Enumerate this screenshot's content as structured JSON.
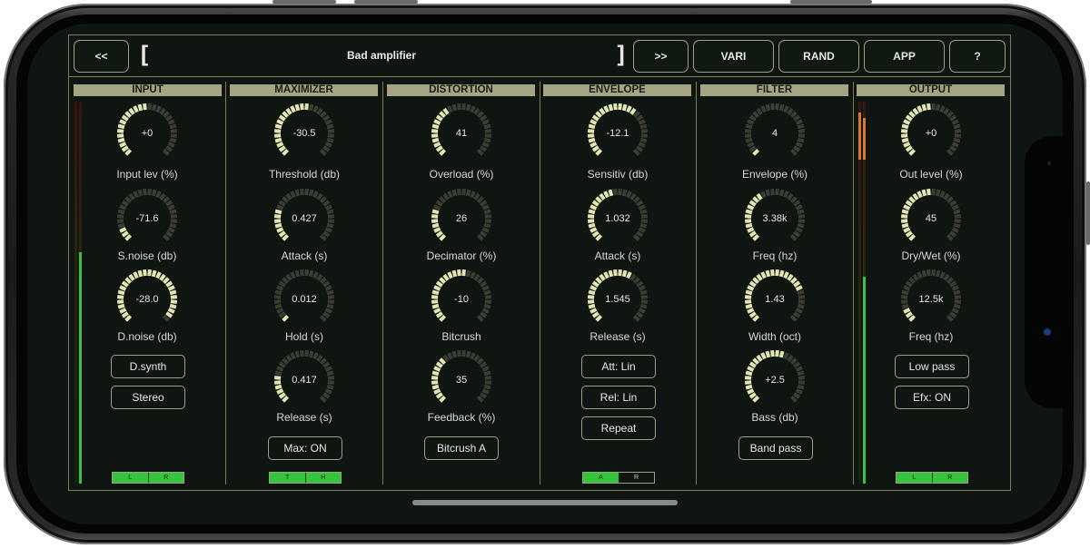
{
  "header": {
    "prev_label": "<<",
    "next_label": ">>",
    "preset_name": "Bad amplifier",
    "bracket_left": "[",
    "bracket_right": "]",
    "vari_label": "VARI",
    "rand_label": "RAND",
    "app_label": "APP",
    "help_label": "?"
  },
  "colors": {
    "accent_green": "#35c43b",
    "knob_on": "#e3e6b4",
    "knob_off": "#3a3d33",
    "header_bg": "#a6a583"
  },
  "sections": {
    "input": {
      "title": "INPUT",
      "knobs": [
        {
          "label": "Input lev (%)",
          "value": "+0",
          "fill": 0.5
        },
        {
          "label": "S.noise (db)",
          "value": "-71.6",
          "fill": 0.1
        },
        {
          "label": "D.noise (db)",
          "value": "-28.0",
          "fill": 0.95
        }
      ],
      "buttons": [
        "D.synth",
        "Stereo"
      ],
      "toggle": [
        "L",
        "R"
      ]
    },
    "maximizer": {
      "title": "MAXIMIZER",
      "knobs": [
        {
          "label": "Threshold (db)",
          "value": "-30.5",
          "fill": 0.55
        },
        {
          "label": "Attack (s)",
          "value": "0.427",
          "fill": 0.25
        },
        {
          "label": "Hold (s)",
          "value": "0.012",
          "fill": 0.05
        },
        {
          "label": "Release (s)",
          "value": "0.417",
          "fill": 0.22
        }
      ],
      "button": "Max: ON",
      "toggle": [
        "T",
        "H"
      ]
    },
    "distortion": {
      "title": "DISTORTION",
      "knobs": [
        {
          "label": "Overload (%)",
          "value": "41",
          "fill": 0.41
        },
        {
          "label": "Decimator (%)",
          "value": "26",
          "fill": 0.26
        },
        {
          "label": "Bitcrush",
          "value": "-10",
          "fill": 0.55
        },
        {
          "label": "Feedback (%)",
          "value": "35",
          "fill": 0.35
        }
      ],
      "button": "Bitcrush A"
    },
    "envelope": {
      "title": "ENVELOPE",
      "knobs": [
        {
          "label": "Sensitiv (db)",
          "value": "-12.1",
          "fill": 0.65
        },
        {
          "label": "Attack (s)",
          "value": "1.032",
          "fill": 0.45
        },
        {
          "label": "Release (s)",
          "value": "1.545",
          "fill": 0.6
        }
      ],
      "buttons": [
        "Att: Lin",
        "Rel: Lin",
        "Repeat"
      ],
      "toggle": [
        "A",
        "R"
      ]
    },
    "filter": {
      "title": "FILTER",
      "knobs": [
        {
          "label": "Envelope (%)",
          "value": "4",
          "fill": 0.04
        },
        {
          "label": "Freq (hz)",
          "value": "3.38k",
          "fill": 0.4
        },
        {
          "label": "Width (oct)",
          "value": "1.43",
          "fill": 0.75
        },
        {
          "label": "Bass (db)",
          "value": "+2.5",
          "fill": 0.58
        }
      ],
      "button": "Band pass"
    },
    "output": {
      "title": "OUTPUT",
      "knobs": [
        {
          "label": "Out level (%)",
          "value": "+0",
          "fill": 0.5
        },
        {
          "label": "Dry/Wet (%)",
          "value": "45",
          "fill": 0.5
        },
        {
          "label": "Freq (hz)",
          "value": "12.5k",
          "fill": 0.12
        }
      ],
      "buttons": [
        "Low pass",
        "Efx: ON"
      ],
      "toggle": [
        "L",
        "R"
      ]
    }
  }
}
